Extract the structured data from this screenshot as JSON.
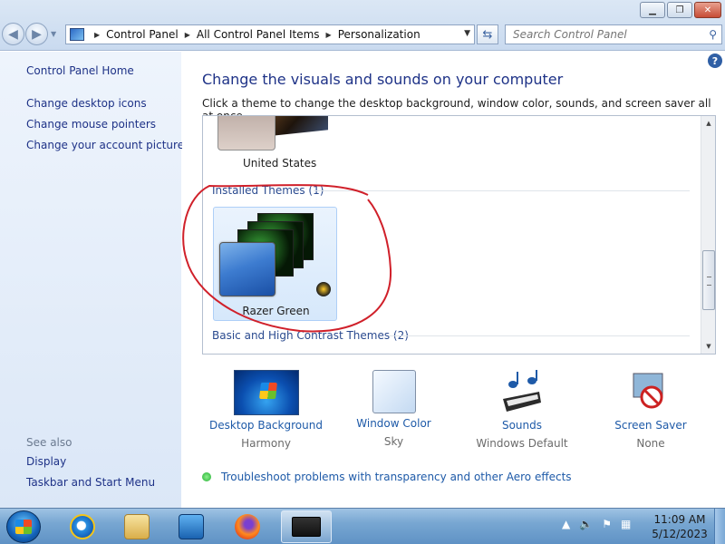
{
  "window": {
    "title_buttons": {
      "minimize": "▁",
      "maximize": "❐",
      "close": "✕"
    }
  },
  "address_bar": {
    "crumbs": [
      "Control Panel",
      "All Control Panel Items",
      "Personalization"
    ]
  },
  "search": {
    "placeholder": "Search Control Panel"
  },
  "left_pane": {
    "home": "Control Panel Home",
    "links": [
      "Change desktop icons",
      "Change mouse pointers",
      "Change your account picture"
    ],
    "see_also_label": "See also",
    "see_also": [
      "Display",
      "Taskbar and Start Menu"
    ]
  },
  "main": {
    "heading": "Change the visuals and sounds on your computer",
    "subheading": "Click a theme to change the desktop background, window color, sounds, and screen saver all at once.",
    "themes": {
      "prev_theme_name": "United States",
      "installed_group": "Installed Themes (1)",
      "installed": [
        {
          "name": "Razer Green"
        }
      ],
      "basic_group": "Basic and High Contrast Themes (2)"
    },
    "bottom_items": [
      {
        "link": "Desktop Background",
        "value": "Harmony"
      },
      {
        "link": "Window Color",
        "value": "Sky"
      },
      {
        "link": "Sounds",
        "value": "Windows Default"
      },
      {
        "link": "Screen Saver",
        "value": "None"
      }
    ],
    "troubleshoot": "Troubleshoot problems with transparency and other Aero effects"
  },
  "taskbar": {
    "clock_time": "11:09 AM",
    "clock_date": "5/12/2023",
    "tray_icons": [
      "chevron-up-icon",
      "volume-icon",
      "flag-icon",
      "network-icon"
    ]
  },
  "colors": {
    "link_blue": "#1e3287",
    "annotation_red": "#d0202a"
  }
}
